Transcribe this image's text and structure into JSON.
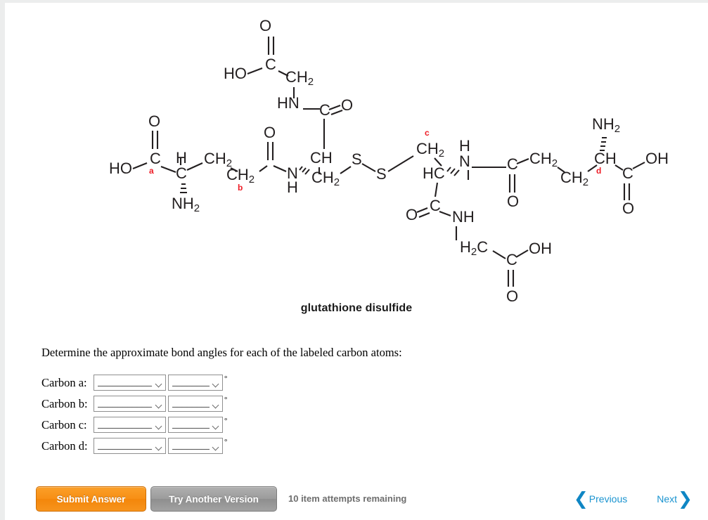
{
  "molecule": {
    "caption": "glutathione disulfide",
    "carbon_labels": [
      "a",
      "b",
      "c",
      "d"
    ],
    "atoms": {
      "HO": "HO",
      "OH": "OH",
      "O": "O",
      "C": "C",
      "N": "N",
      "H": "H",
      "S": "S",
      "HN": "HN",
      "NH": "NH",
      "CH": "CH",
      "HC": "HC",
      "CH2": "CH",
      "CH2_sub": "2",
      "NH2": "NH",
      "NH2_sub": "2",
      "H2C": "H",
      "H2C_sub": "2",
      "H2C_rest": "C"
    }
  },
  "prompt": {
    "text": "Determine the approximate bond angles for each of the labeled carbon atoms:"
  },
  "answers": {
    "degree_symbol": "°",
    "blank_long": "___________",
    "blank_short": "________",
    "rows": [
      {
        "label": "Carbon a:",
        "shape_value": "___________",
        "angle_value": "________"
      },
      {
        "label": "Carbon b:",
        "shape_value": "___________",
        "angle_value": "________"
      },
      {
        "label": "Carbon c:",
        "shape_value": "___________",
        "angle_value": "________"
      },
      {
        "label": "Carbon d:",
        "shape_value": "___________",
        "angle_value": "________"
      }
    ]
  },
  "footer": {
    "submit_label": "Submit Answer",
    "try_another_label": "Try Another Version",
    "attempts_text": "10 item attempts remaining",
    "previous_label": "Previous",
    "next_label": "Next",
    "prev_chevron": "❮",
    "next_chevron": "❯",
    "submit_color": "#f7941d",
    "try_color": "#9b9b9b",
    "nav_color": "#1b94d0",
    "attempts_color": "#6e6e6e"
  }
}
